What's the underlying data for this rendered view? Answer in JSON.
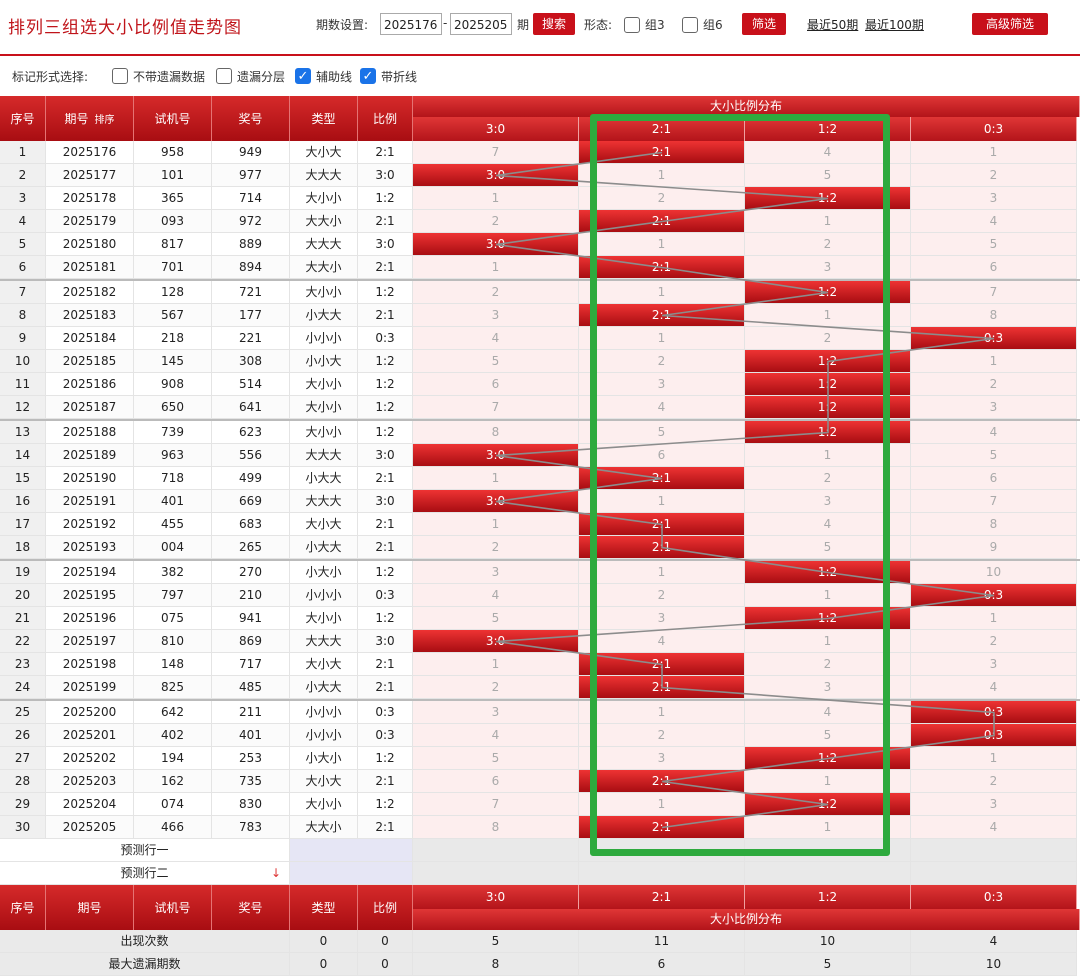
{
  "header": {
    "title": "排列三组选大小比例值走势图",
    "period_label": "期数设置:",
    "period_from": "2025176",
    "period_dash": "-",
    "period_to": "2025205",
    "period_unit": "期",
    "search_label": "搜索",
    "form_label": "形态:",
    "group3_label": "组3",
    "group6_label": "组6",
    "filter_label": "筛选",
    "recent50_label": "最近50期",
    "recent100_label": "最近100期",
    "advanced_label": "高级筛选"
  },
  "options": {
    "prompt": "标记形式选择:",
    "items": [
      {
        "label": "不带遗漏数据",
        "checked": false
      },
      {
        "label": "遗漏分层",
        "checked": false
      },
      {
        "label": "辅助线",
        "checked": true
      },
      {
        "label": "带折线",
        "checked": true
      }
    ]
  },
  "table": {
    "headers": {
      "seq": "序号",
      "issue": "期号",
      "sort": "排序",
      "trial": "试机号",
      "prize": "奖号",
      "type": "类型",
      "ratio": "比例",
      "dist": "大小比例分布",
      "cols": [
        "3:0",
        "2:1",
        "1:2",
        "0:3"
      ]
    },
    "rows": [
      {
        "seq": "1",
        "issue": "2025176",
        "trial": "958",
        "prize": "949",
        "type": "大小大",
        "ratio": "2:1",
        "d": [
          "7",
          "2:1",
          "4",
          "1"
        ],
        "hit": 1
      },
      {
        "seq": "2",
        "issue": "2025177",
        "trial": "101",
        "prize": "977",
        "type": "大大大",
        "ratio": "3:0",
        "d": [
          "3:0",
          "1",
          "5",
          "2"
        ],
        "hit": 0
      },
      {
        "seq": "3",
        "issue": "2025178",
        "trial": "365",
        "prize": "714",
        "type": "大小小",
        "ratio": "1:2",
        "d": [
          "1",
          "2",
          "1:2",
          "3"
        ],
        "hit": 2
      },
      {
        "seq": "4",
        "issue": "2025179",
        "trial": "093",
        "prize": "972",
        "type": "大大小",
        "ratio": "2:1",
        "d": [
          "2",
          "2:1",
          "1",
          "4"
        ],
        "hit": 1
      },
      {
        "seq": "5",
        "issue": "2025180",
        "trial": "817",
        "prize": "889",
        "type": "大大大",
        "ratio": "3:0",
        "d": [
          "3:0",
          "1",
          "2",
          "5"
        ],
        "hit": 0
      },
      {
        "seq": "6",
        "issue": "2025181",
        "trial": "701",
        "prize": "894",
        "type": "大大小",
        "ratio": "2:1",
        "d": [
          "1",
          "2:1",
          "3",
          "6"
        ],
        "hit": 1
      },
      {
        "seq": "7",
        "issue": "2025182",
        "trial": "128",
        "prize": "721",
        "type": "大小小",
        "ratio": "1:2",
        "d": [
          "2",
          "1",
          "1:2",
          "7"
        ],
        "hit": 2
      },
      {
        "seq": "8",
        "issue": "2025183",
        "trial": "567",
        "prize": "177",
        "type": "小大大",
        "ratio": "2:1",
        "d": [
          "3",
          "2:1",
          "1",
          "8"
        ],
        "hit": 1
      },
      {
        "seq": "9",
        "issue": "2025184",
        "trial": "218",
        "prize": "221",
        "type": "小小小",
        "ratio": "0:3",
        "d": [
          "4",
          "1",
          "2",
          "0:3"
        ],
        "hit": 3
      },
      {
        "seq": "10",
        "issue": "2025185",
        "trial": "145",
        "prize": "308",
        "type": "小小大",
        "ratio": "1:2",
        "d": [
          "5",
          "2",
          "1:2",
          "1"
        ],
        "hit": 2
      },
      {
        "seq": "11",
        "issue": "2025186",
        "trial": "908",
        "prize": "514",
        "type": "大小小",
        "ratio": "1:2",
        "d": [
          "6",
          "3",
          "1:2",
          "2"
        ],
        "hit": 2
      },
      {
        "seq": "12",
        "issue": "2025187",
        "trial": "650",
        "prize": "641",
        "type": "大小小",
        "ratio": "1:2",
        "d": [
          "7",
          "4",
          "1:2",
          "3"
        ],
        "hit": 2
      },
      {
        "seq": "13",
        "issue": "2025188",
        "trial": "739",
        "prize": "623",
        "type": "大小小",
        "ratio": "1:2",
        "d": [
          "8",
          "5",
          "1:2",
          "4"
        ],
        "hit": 2
      },
      {
        "seq": "14",
        "issue": "2025189",
        "trial": "963",
        "prize": "556",
        "type": "大大大",
        "ratio": "3:0",
        "d": [
          "3:0",
          "6",
          "1",
          "5"
        ],
        "hit": 0
      },
      {
        "seq": "15",
        "issue": "2025190",
        "trial": "718",
        "prize": "499",
        "type": "小大大",
        "ratio": "2:1",
        "d": [
          "1",
          "2:1",
          "2",
          "6"
        ],
        "hit": 1
      },
      {
        "seq": "16",
        "issue": "2025191",
        "trial": "401",
        "prize": "669",
        "type": "大大大",
        "ratio": "3:0",
        "d": [
          "3:0",
          "1",
          "3",
          "7"
        ],
        "hit": 0
      },
      {
        "seq": "17",
        "issue": "2025192",
        "trial": "455",
        "prize": "683",
        "type": "大小大",
        "ratio": "2:1",
        "d": [
          "1",
          "2:1",
          "4",
          "8"
        ],
        "hit": 1
      },
      {
        "seq": "18",
        "issue": "2025193",
        "trial": "004",
        "prize": "265",
        "type": "小大大",
        "ratio": "2:1",
        "d": [
          "2",
          "2:1",
          "5",
          "9"
        ],
        "hit": 1
      },
      {
        "seq": "19",
        "issue": "2025194",
        "trial": "382",
        "prize": "270",
        "type": "小大小",
        "ratio": "1:2",
        "d": [
          "3",
          "1",
          "1:2",
          "10"
        ],
        "hit": 2
      },
      {
        "seq": "20",
        "issue": "2025195",
        "trial": "797",
        "prize": "210",
        "type": "小小小",
        "ratio": "0:3",
        "d": [
          "4",
          "2",
          "1",
          "0:3"
        ],
        "hit": 3
      },
      {
        "seq": "21",
        "issue": "2025196",
        "trial": "075",
        "prize": "941",
        "type": "大小小",
        "ratio": "1:2",
        "d": [
          "5",
          "3",
          "1:2",
          "1"
        ],
        "hit": 2
      },
      {
        "seq": "22",
        "issue": "2025197",
        "trial": "810",
        "prize": "869",
        "type": "大大大",
        "ratio": "3:0",
        "d": [
          "3:0",
          "4",
          "1",
          "2"
        ],
        "hit": 0
      },
      {
        "seq": "23",
        "issue": "2025198",
        "trial": "148",
        "prize": "717",
        "type": "大小大",
        "ratio": "2:1",
        "d": [
          "1",
          "2:1",
          "2",
          "3"
        ],
        "hit": 1
      },
      {
        "seq": "24",
        "issue": "2025199",
        "trial": "825",
        "prize": "485",
        "type": "小大大",
        "ratio": "2:1",
        "d": [
          "2",
          "2:1",
          "3",
          "4"
        ],
        "hit": 1
      },
      {
        "seq": "25",
        "issue": "2025200",
        "trial": "642",
        "prize": "211",
        "type": "小小小",
        "ratio": "0:3",
        "d": [
          "3",
          "1",
          "4",
          "0:3"
        ],
        "hit": 3
      },
      {
        "seq": "26",
        "issue": "2025201",
        "trial": "402",
        "prize": "401",
        "type": "小小小",
        "ratio": "0:3",
        "d": [
          "4",
          "2",
          "5",
          "0:3"
        ],
        "hit": 3
      },
      {
        "seq": "27",
        "issue": "2025202",
        "trial": "194",
        "prize": "253",
        "type": "小大小",
        "ratio": "1:2",
        "d": [
          "5",
          "3",
          "1:2",
          "1"
        ],
        "hit": 2
      },
      {
        "seq": "28",
        "issue": "2025203",
        "trial": "162",
        "prize": "735",
        "type": "大小大",
        "ratio": "2:1",
        "d": [
          "6",
          "2:1",
          "1",
          "2"
        ],
        "hit": 1
      },
      {
        "seq": "29",
        "issue": "2025204",
        "trial": "074",
        "prize": "830",
        "type": "大小小",
        "ratio": "1:2",
        "d": [
          "7",
          "1",
          "1:2",
          "3"
        ],
        "hit": 2
      },
      {
        "seq": "30",
        "issue": "2025205",
        "trial": "466",
        "prize": "783",
        "type": "大大小",
        "ratio": "2:1",
        "d": [
          "8",
          "2:1",
          "1",
          "4"
        ],
        "hit": 1
      }
    ],
    "predict1": "预测行一",
    "predict2": "预测行二",
    "stats": [
      {
        "label": "出现次数",
        "type": "0",
        "ratio": "0",
        "d": [
          "5",
          "11",
          "10",
          "4"
        ]
      },
      {
        "label": "最大遗漏期数",
        "type": "0",
        "ratio": "0",
        "d": [
          "8",
          "6",
          "5",
          "10"
        ]
      }
    ]
  },
  "colors": {
    "accent": "#c8101a",
    "highlight_frame": "#2eaa3e"
  }
}
